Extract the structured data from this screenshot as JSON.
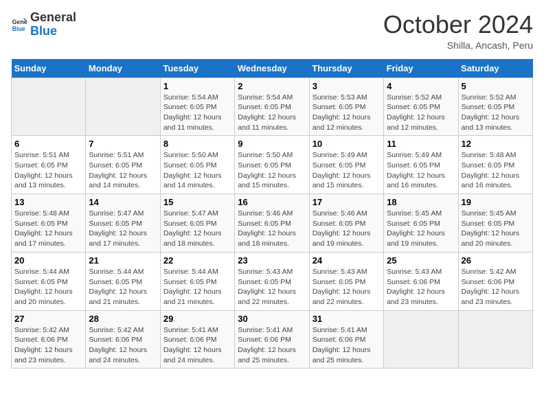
{
  "logo": {
    "line1": "General",
    "line2": "Blue"
  },
  "title": "October 2024",
  "location": "Shilla, Ancash, Peru",
  "weekdays": [
    "Sunday",
    "Monday",
    "Tuesday",
    "Wednesday",
    "Thursday",
    "Friday",
    "Saturday"
  ],
  "weeks": [
    [
      {
        "day": "",
        "sunrise": "",
        "sunset": "",
        "daylight": ""
      },
      {
        "day": "",
        "sunrise": "",
        "sunset": "",
        "daylight": ""
      },
      {
        "day": "1",
        "sunrise": "Sunrise: 5:54 AM",
        "sunset": "Sunset: 6:05 PM",
        "daylight": "Daylight: 12 hours and 11 minutes."
      },
      {
        "day": "2",
        "sunrise": "Sunrise: 5:54 AM",
        "sunset": "Sunset: 6:05 PM",
        "daylight": "Daylight: 12 hours and 11 minutes."
      },
      {
        "day": "3",
        "sunrise": "Sunrise: 5:53 AM",
        "sunset": "Sunset: 6:05 PM",
        "daylight": "Daylight: 12 hours and 12 minutes."
      },
      {
        "day": "4",
        "sunrise": "Sunrise: 5:52 AM",
        "sunset": "Sunset: 6:05 PM",
        "daylight": "Daylight: 12 hours and 12 minutes."
      },
      {
        "day": "5",
        "sunrise": "Sunrise: 5:52 AM",
        "sunset": "Sunset: 6:05 PM",
        "daylight": "Daylight: 12 hours and 13 minutes."
      }
    ],
    [
      {
        "day": "6",
        "sunrise": "Sunrise: 5:51 AM",
        "sunset": "Sunset: 6:05 PM",
        "daylight": "Daylight: 12 hours and 13 minutes."
      },
      {
        "day": "7",
        "sunrise": "Sunrise: 5:51 AM",
        "sunset": "Sunset: 6:05 PM",
        "daylight": "Daylight: 12 hours and 14 minutes."
      },
      {
        "day": "8",
        "sunrise": "Sunrise: 5:50 AM",
        "sunset": "Sunset: 6:05 PM",
        "daylight": "Daylight: 12 hours and 14 minutes."
      },
      {
        "day": "9",
        "sunrise": "Sunrise: 5:50 AM",
        "sunset": "Sunset: 6:05 PM",
        "daylight": "Daylight: 12 hours and 15 minutes."
      },
      {
        "day": "10",
        "sunrise": "Sunrise: 5:49 AM",
        "sunset": "Sunset: 6:05 PM",
        "daylight": "Daylight: 12 hours and 15 minutes."
      },
      {
        "day": "11",
        "sunrise": "Sunrise: 5:49 AM",
        "sunset": "Sunset: 6:05 PM",
        "daylight": "Daylight: 12 hours and 16 minutes."
      },
      {
        "day": "12",
        "sunrise": "Sunrise: 5:48 AM",
        "sunset": "Sunset: 6:05 PM",
        "daylight": "Daylight: 12 hours and 16 minutes."
      }
    ],
    [
      {
        "day": "13",
        "sunrise": "Sunrise: 5:48 AM",
        "sunset": "Sunset: 6:05 PM",
        "daylight": "Daylight: 12 hours and 17 minutes."
      },
      {
        "day": "14",
        "sunrise": "Sunrise: 5:47 AM",
        "sunset": "Sunset: 6:05 PM",
        "daylight": "Daylight: 12 hours and 17 minutes."
      },
      {
        "day": "15",
        "sunrise": "Sunrise: 5:47 AM",
        "sunset": "Sunset: 6:05 PM",
        "daylight": "Daylight: 12 hours and 18 minutes."
      },
      {
        "day": "16",
        "sunrise": "Sunrise: 5:46 AM",
        "sunset": "Sunset: 6:05 PM",
        "daylight": "Daylight: 12 hours and 18 minutes."
      },
      {
        "day": "17",
        "sunrise": "Sunrise: 5:46 AM",
        "sunset": "Sunset: 6:05 PM",
        "daylight": "Daylight: 12 hours and 19 minutes."
      },
      {
        "day": "18",
        "sunrise": "Sunrise: 5:45 AM",
        "sunset": "Sunset: 6:05 PM",
        "daylight": "Daylight: 12 hours and 19 minutes."
      },
      {
        "day": "19",
        "sunrise": "Sunrise: 5:45 AM",
        "sunset": "Sunset: 6:05 PM",
        "daylight": "Daylight: 12 hours and 20 minutes."
      }
    ],
    [
      {
        "day": "20",
        "sunrise": "Sunrise: 5:44 AM",
        "sunset": "Sunset: 6:05 PM",
        "daylight": "Daylight: 12 hours and 20 minutes."
      },
      {
        "day": "21",
        "sunrise": "Sunrise: 5:44 AM",
        "sunset": "Sunset: 6:05 PM",
        "daylight": "Daylight: 12 hours and 21 minutes."
      },
      {
        "day": "22",
        "sunrise": "Sunrise: 5:44 AM",
        "sunset": "Sunset: 6:05 PM",
        "daylight": "Daylight: 12 hours and 21 minutes."
      },
      {
        "day": "23",
        "sunrise": "Sunrise: 5:43 AM",
        "sunset": "Sunset: 6:05 PM",
        "daylight": "Daylight: 12 hours and 22 minutes."
      },
      {
        "day": "24",
        "sunrise": "Sunrise: 5:43 AM",
        "sunset": "Sunset: 6:05 PM",
        "daylight": "Daylight: 12 hours and 22 minutes."
      },
      {
        "day": "25",
        "sunrise": "Sunrise: 5:43 AM",
        "sunset": "Sunset: 6:06 PM",
        "daylight": "Daylight: 12 hours and 23 minutes."
      },
      {
        "day": "26",
        "sunrise": "Sunrise: 5:42 AM",
        "sunset": "Sunset: 6:06 PM",
        "daylight": "Daylight: 12 hours and 23 minutes."
      }
    ],
    [
      {
        "day": "27",
        "sunrise": "Sunrise: 5:42 AM",
        "sunset": "Sunset: 6:06 PM",
        "daylight": "Daylight: 12 hours and 23 minutes."
      },
      {
        "day": "28",
        "sunrise": "Sunrise: 5:42 AM",
        "sunset": "Sunset: 6:06 PM",
        "daylight": "Daylight: 12 hours and 24 minutes."
      },
      {
        "day": "29",
        "sunrise": "Sunrise: 5:41 AM",
        "sunset": "Sunset: 6:06 PM",
        "daylight": "Daylight: 12 hours and 24 minutes."
      },
      {
        "day": "30",
        "sunrise": "Sunrise: 5:41 AM",
        "sunset": "Sunset: 6:06 PM",
        "daylight": "Daylight: 12 hours and 25 minutes."
      },
      {
        "day": "31",
        "sunrise": "Sunrise: 5:41 AM",
        "sunset": "Sunset: 6:06 PM",
        "daylight": "Daylight: 12 hours and 25 minutes."
      },
      {
        "day": "",
        "sunrise": "",
        "sunset": "",
        "daylight": ""
      },
      {
        "day": "",
        "sunrise": "",
        "sunset": "",
        "daylight": ""
      }
    ]
  ]
}
